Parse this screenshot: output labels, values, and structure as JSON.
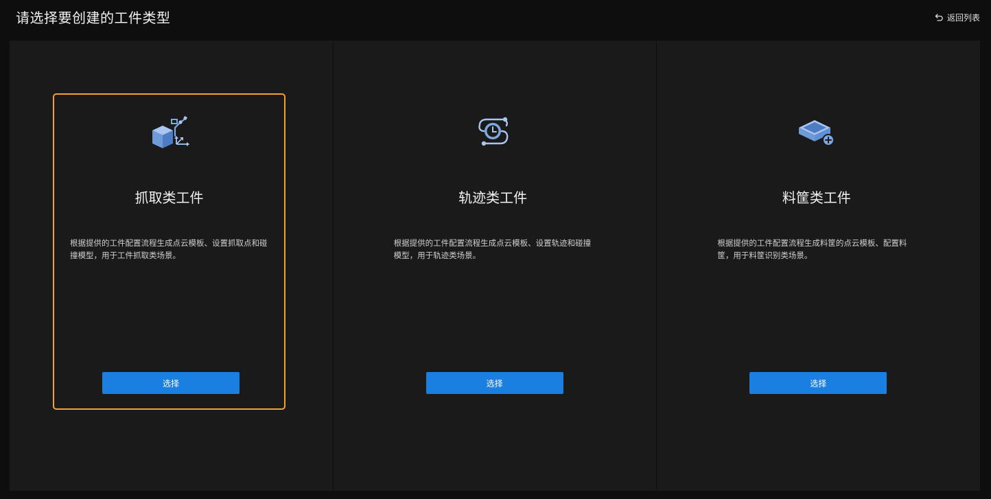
{
  "header": {
    "title": "请选择要创建的工件类型",
    "back_label": "返回列表",
    "back_icon": "undo-arrow-icon"
  },
  "colors": {
    "background": "#0e0e0e",
    "panel": "#1a1a1a",
    "selected_border": "#f0a233",
    "button": "#1a7fe0",
    "icon_primary": "#5f8fd6",
    "icon_light": "#a9c6f0"
  },
  "cards": [
    {
      "id": "picking",
      "icon": "box-with-robot-arm-icon",
      "title": "抓取类工件",
      "description": "根据提供的工件配置流程生成点云模板、设置抓取点和碰撞模型，用于工件抓取类场景。",
      "button_label": "选择",
      "selected": true
    },
    {
      "id": "trajectory",
      "icon": "trajectory-path-icon",
      "title": "轨迹类工件",
      "description": "根据提供的工件配置流程生成点云模板、设置轨迹和碰撞模型，用于轨迹类场景。",
      "button_label": "选择",
      "selected": false
    },
    {
      "id": "bin",
      "icon": "bin-add-icon",
      "title": "料筐类工件",
      "description": "根据提供的工件配置流程生成料筐的点云模板、配置料筐，用于料筐识别类场景。",
      "button_label": "选择",
      "selected": false
    }
  ]
}
